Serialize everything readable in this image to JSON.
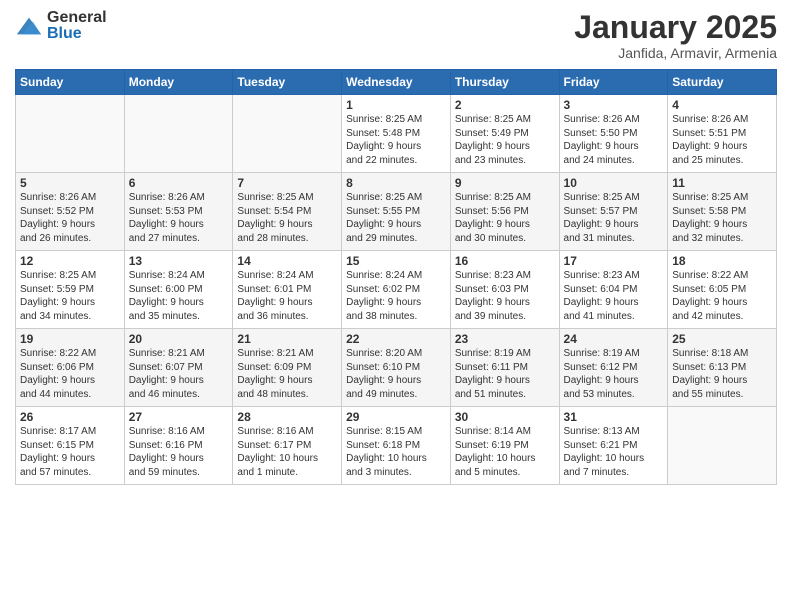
{
  "header": {
    "logo_general": "General",
    "logo_blue": "Blue",
    "month_title": "January 2025",
    "location": "Janfida, Armavir, Armenia"
  },
  "weekdays": [
    "Sunday",
    "Monday",
    "Tuesday",
    "Wednesday",
    "Thursday",
    "Friday",
    "Saturday"
  ],
  "weeks": [
    [
      {
        "day": "",
        "info": ""
      },
      {
        "day": "",
        "info": ""
      },
      {
        "day": "",
        "info": ""
      },
      {
        "day": "1",
        "info": "Sunrise: 8:25 AM\nSunset: 5:48 PM\nDaylight: 9 hours\nand 22 minutes."
      },
      {
        "day": "2",
        "info": "Sunrise: 8:25 AM\nSunset: 5:49 PM\nDaylight: 9 hours\nand 23 minutes."
      },
      {
        "day": "3",
        "info": "Sunrise: 8:26 AM\nSunset: 5:50 PM\nDaylight: 9 hours\nand 24 minutes."
      },
      {
        "day": "4",
        "info": "Sunrise: 8:26 AM\nSunset: 5:51 PM\nDaylight: 9 hours\nand 25 minutes."
      }
    ],
    [
      {
        "day": "5",
        "info": "Sunrise: 8:26 AM\nSunset: 5:52 PM\nDaylight: 9 hours\nand 26 minutes."
      },
      {
        "day": "6",
        "info": "Sunrise: 8:26 AM\nSunset: 5:53 PM\nDaylight: 9 hours\nand 27 minutes."
      },
      {
        "day": "7",
        "info": "Sunrise: 8:25 AM\nSunset: 5:54 PM\nDaylight: 9 hours\nand 28 minutes."
      },
      {
        "day": "8",
        "info": "Sunrise: 8:25 AM\nSunset: 5:55 PM\nDaylight: 9 hours\nand 29 minutes."
      },
      {
        "day": "9",
        "info": "Sunrise: 8:25 AM\nSunset: 5:56 PM\nDaylight: 9 hours\nand 30 minutes."
      },
      {
        "day": "10",
        "info": "Sunrise: 8:25 AM\nSunset: 5:57 PM\nDaylight: 9 hours\nand 31 minutes."
      },
      {
        "day": "11",
        "info": "Sunrise: 8:25 AM\nSunset: 5:58 PM\nDaylight: 9 hours\nand 32 minutes."
      }
    ],
    [
      {
        "day": "12",
        "info": "Sunrise: 8:25 AM\nSunset: 5:59 PM\nDaylight: 9 hours\nand 34 minutes."
      },
      {
        "day": "13",
        "info": "Sunrise: 8:24 AM\nSunset: 6:00 PM\nDaylight: 9 hours\nand 35 minutes."
      },
      {
        "day": "14",
        "info": "Sunrise: 8:24 AM\nSunset: 6:01 PM\nDaylight: 9 hours\nand 36 minutes."
      },
      {
        "day": "15",
        "info": "Sunrise: 8:24 AM\nSunset: 6:02 PM\nDaylight: 9 hours\nand 38 minutes."
      },
      {
        "day": "16",
        "info": "Sunrise: 8:23 AM\nSunset: 6:03 PM\nDaylight: 9 hours\nand 39 minutes."
      },
      {
        "day": "17",
        "info": "Sunrise: 8:23 AM\nSunset: 6:04 PM\nDaylight: 9 hours\nand 41 minutes."
      },
      {
        "day": "18",
        "info": "Sunrise: 8:22 AM\nSunset: 6:05 PM\nDaylight: 9 hours\nand 42 minutes."
      }
    ],
    [
      {
        "day": "19",
        "info": "Sunrise: 8:22 AM\nSunset: 6:06 PM\nDaylight: 9 hours\nand 44 minutes."
      },
      {
        "day": "20",
        "info": "Sunrise: 8:21 AM\nSunset: 6:07 PM\nDaylight: 9 hours\nand 46 minutes."
      },
      {
        "day": "21",
        "info": "Sunrise: 8:21 AM\nSunset: 6:09 PM\nDaylight: 9 hours\nand 48 minutes."
      },
      {
        "day": "22",
        "info": "Sunrise: 8:20 AM\nSunset: 6:10 PM\nDaylight: 9 hours\nand 49 minutes."
      },
      {
        "day": "23",
        "info": "Sunrise: 8:19 AM\nSunset: 6:11 PM\nDaylight: 9 hours\nand 51 minutes."
      },
      {
        "day": "24",
        "info": "Sunrise: 8:19 AM\nSunset: 6:12 PM\nDaylight: 9 hours\nand 53 minutes."
      },
      {
        "day": "25",
        "info": "Sunrise: 8:18 AM\nSunset: 6:13 PM\nDaylight: 9 hours\nand 55 minutes."
      }
    ],
    [
      {
        "day": "26",
        "info": "Sunrise: 8:17 AM\nSunset: 6:15 PM\nDaylight: 9 hours\nand 57 minutes."
      },
      {
        "day": "27",
        "info": "Sunrise: 8:16 AM\nSunset: 6:16 PM\nDaylight: 9 hours\nand 59 minutes."
      },
      {
        "day": "28",
        "info": "Sunrise: 8:16 AM\nSunset: 6:17 PM\nDaylight: 10 hours\nand 1 minute."
      },
      {
        "day": "29",
        "info": "Sunrise: 8:15 AM\nSunset: 6:18 PM\nDaylight: 10 hours\nand 3 minutes."
      },
      {
        "day": "30",
        "info": "Sunrise: 8:14 AM\nSunset: 6:19 PM\nDaylight: 10 hours\nand 5 minutes."
      },
      {
        "day": "31",
        "info": "Sunrise: 8:13 AM\nSunset: 6:21 PM\nDaylight: 10 hours\nand 7 minutes."
      },
      {
        "day": "",
        "info": ""
      }
    ]
  ]
}
